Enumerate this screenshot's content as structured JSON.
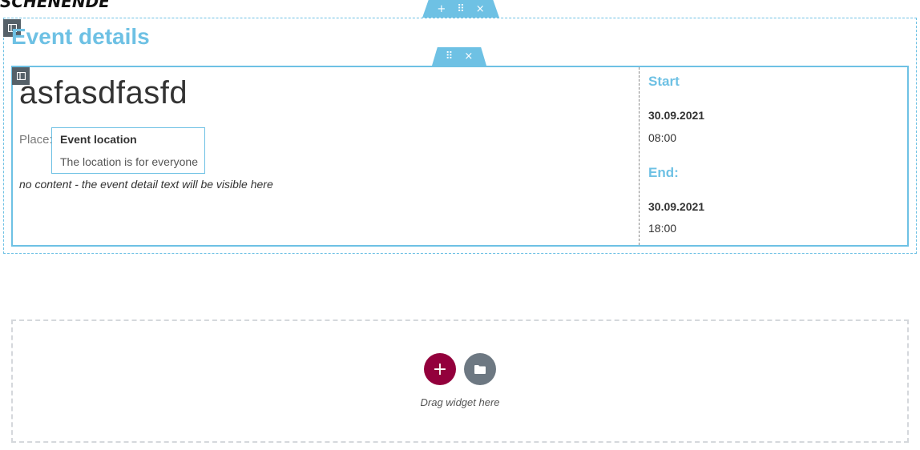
{
  "logo": {
    "text": "SCHENENDE"
  },
  "section": {
    "handle": {
      "add_icon": "+",
      "drag_icon": "⠿",
      "close_icon": "×"
    },
    "title": "Event details"
  },
  "inner_section": {
    "handle": {
      "drag_icon": "⠿",
      "close_icon": "×"
    },
    "event_name": "asfasdfasfd",
    "place_label": "Place:",
    "location": {
      "name": "Event location",
      "description": "The location is for everyone"
    },
    "no_content_text": "no content - the event detail text will be visible here",
    "start": {
      "heading": "Start",
      "date": "30.09.2021",
      "time": "08:00"
    },
    "end": {
      "heading": "End:",
      "date": "30.09.2021",
      "time": "18:00"
    }
  },
  "drop_zone": {
    "add_button_icon": "+",
    "template_button_icon": "folder-icon",
    "drag_text": "Drag widget here"
  },
  "colors": {
    "accent": "#6ec1e4",
    "add_button": "#93003c",
    "template_button": "#6d7882"
  }
}
